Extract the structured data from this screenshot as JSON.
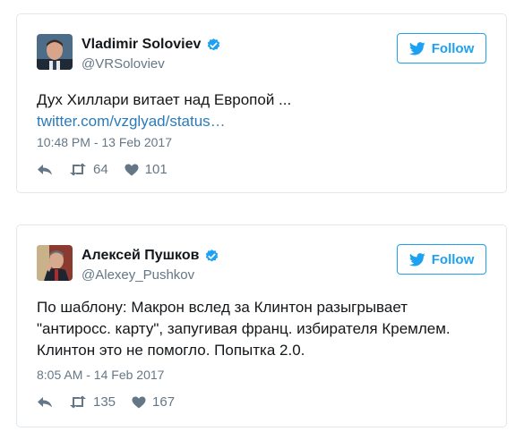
{
  "tweets": [
    {
      "author_name": "Vladimir Soloviev",
      "handle": "@VRSoloviev",
      "follow_label": "Follow",
      "text_line1": "Дух Хиллари витает над Европой ...",
      "link": "twitter.com/vzglyad/status…",
      "timestamp": "10:48 PM - 13 Feb 2017",
      "retweets": "64",
      "likes": "101"
    },
    {
      "author_name": "Алексей Пушков",
      "handle": "@Alexey_Pushkov",
      "follow_label": "Follow",
      "text_lines": [
        "По шаблону: Макрон вслед за Клинтон разыгрывает",
        "\"антиросс. карту\", запугивая франц. избирателя Кремлем.",
        "Клинтон это не помогло. Попытка 2.0."
      ],
      "timestamp": "8:05 AM - 14 Feb 2017",
      "retweets": "135",
      "likes": "167"
    }
  ],
  "colors": {
    "accent": "#1da1f2",
    "link": "#2b7bb9",
    "muted": "#657786",
    "border": "#e1e8ed"
  },
  "icons": [
    "verified-badge-icon",
    "twitter-bird-icon",
    "reply-icon",
    "retweet-icon",
    "heart-icon"
  ]
}
